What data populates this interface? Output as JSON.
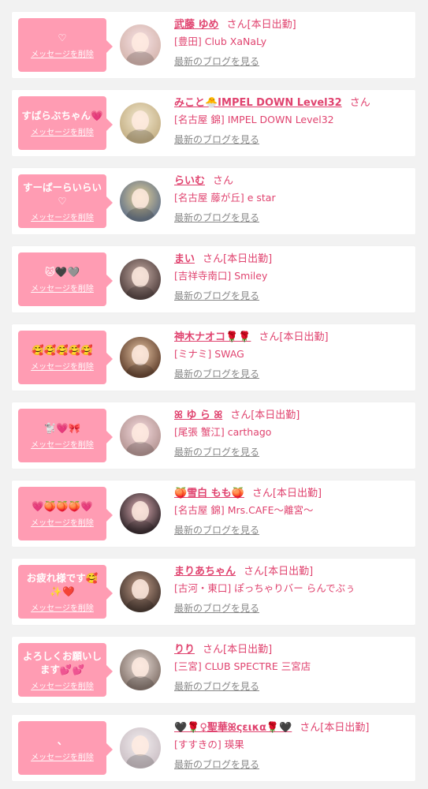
{
  "colors": {
    "bubble": "#ff9cb3",
    "accent": "#e0436f",
    "muted": "#888888",
    "background": "#f2f2f2"
  },
  "labels": {
    "delete_message": "メッセージを削除",
    "blog_link": "最新のブログを見る",
    "san": "さん"
  },
  "items": [
    {
      "message": "♡",
      "name": "武藤 ゆめ",
      "status": "[本日出勤]",
      "shop": "[豊田] Club XaNaLy",
      "avatar_colors": [
        "#f7e3e6",
        "#d8b9b2"
      ]
    },
    {
      "message": "すばらぶちゃん💗",
      "name": "みこと🐣IMPEL DOWN Level32",
      "status": "",
      "shop": "[名古屋 錦] IMPEL DOWN Level32",
      "avatar_colors": [
        "#f4ead2",
        "#c8b48a"
      ]
    },
    {
      "message": "すーぱーらいらい♡",
      "name": "らいむ",
      "status": "",
      "shop": "[名古屋 藤が丘] e star",
      "avatar_colors": [
        "#e7d39a",
        "#6d7a8a"
      ]
    },
    {
      "message": "🐱🖤🩶",
      "name": "まい",
      "status": "[本日出勤]",
      "shop": "[吉祥寺南口] Smiley",
      "avatar_colors": [
        "#c9b0a8",
        "#5a4846"
      ]
    },
    {
      "message": "🥰🥰🥰🥰🥰",
      "name": "神木ナオコ🌹🌹",
      "status": "[本日出勤]",
      "shop": "[ミナミ] SWAG",
      "avatar_colors": [
        "#e9c7a6",
        "#6b4a36"
      ]
    },
    {
      "message": "🐩💗🎀",
      "name": "ꕤ ゆ ら ꕤ",
      "status": "[本日出勤]",
      "shop": "[尾張 蟹江] carthago",
      "avatar_colors": [
        "#f6dce0",
        "#b99a98"
      ]
    },
    {
      "message": "💗🍑🍑🍑💗",
      "name": "🍑雪白 もも🍑",
      "status": "[本日出勤]",
      "shop": "[名古屋 錦] Mrs.CAFE〜離宮〜",
      "avatar_colors": [
        "#e2b2b8",
        "#3c2f33"
      ]
    },
    {
      "message": "お疲れ様です🥰✨❤️",
      "name": "まりあちゃん",
      "status": "[本日出勤]",
      "shop": "[古河・東口] ぽっちゃりバー らんでぶぅ",
      "avatar_colors": [
        "#c5a08b",
        "#4e3d35"
      ]
    },
    {
      "message": "よろしくお願いします💕💕",
      "name": "りり",
      "status": "[本日出勤]",
      "shop": "[三宮] CLUB SPECTRE 三宮店",
      "avatar_colors": [
        "#e8dcd6",
        "#8b7b73"
      ]
    },
    {
      "message": "、",
      "name": "🖤🌹♀聖華ꕤςεικα🌹🖤",
      "status": "[本日出勤]",
      "shop": "[すすきの] 瑛果",
      "avatar_colors": [
        "#f2eef0",
        "#cfc4c9"
      ]
    }
  ]
}
